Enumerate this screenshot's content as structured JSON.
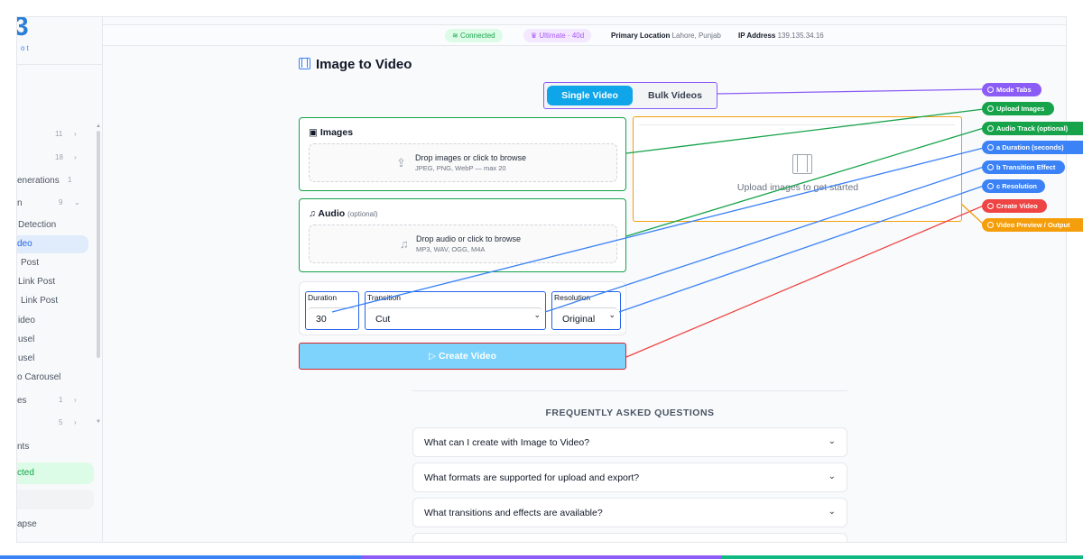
{
  "sidebar": {
    "logo_mark": "3",
    "logo_sub": "ot",
    "items": [
      {
        "label": "",
        "count": "11"
      },
      {
        "label": "",
        "count": "18"
      },
      {
        "label": "enerations",
        "count": "1"
      },
      {
        "label": "n",
        "count": "9"
      },
      {
        "label": "Detection",
        "count": ""
      },
      {
        "label": "deo",
        "count": ""
      },
      {
        "label": "Post",
        "count": ""
      },
      {
        "label": "Link Post",
        "count": ""
      },
      {
        "label": "Link Post",
        "count": ""
      },
      {
        "label": "ideo",
        "count": ""
      },
      {
        "label": "usel",
        "count": ""
      },
      {
        "label": "usel",
        "count": ""
      },
      {
        "label": "o Carousel",
        "count": ""
      },
      {
        "label": "es",
        "count": "1"
      },
      {
        "label": "",
        "count": "5"
      }
    ],
    "bottom_item": "nts",
    "status": "cted",
    "collapse": "apse"
  },
  "topbar": {
    "connected": "Connected",
    "plan": "Ultimate · 40d",
    "location_label": "Primary Location",
    "location_value": "Lahore, Punjab",
    "ip_label": "IP Address",
    "ip_value": "139.135.34.16"
  },
  "main": {
    "title": "Image to Video",
    "tabs": [
      {
        "label": "Single Video",
        "active": true
      },
      {
        "label": "Bulk Videos",
        "active": false
      }
    ],
    "images": {
      "title": "Images",
      "drop_text": "Drop images or click to browse",
      "formats": "JPEG, PNG, WebP — max 20"
    },
    "audio": {
      "title": "Audio",
      "optional": "(optional)",
      "drop_text": "Drop audio or click to browse",
      "formats": "MP3, WAV, OGG, M4A"
    },
    "preview_text": "Upload images to get started",
    "settings": {
      "duration_label": "Duration",
      "duration_value": "30",
      "transition_label": "Transition",
      "transition_value": "Cut",
      "resolution_label": "Resolution",
      "resolution_value": "Original"
    },
    "create_button": "Create Video"
  },
  "faq": {
    "heading": "FREQUENTLY ASKED QUESTIONS",
    "items": [
      "What can I create with Image to Video?",
      "What formats are supported for upload and export?",
      "What transitions and effects are available?"
    ]
  },
  "annotations": [
    {
      "label": "Mode Tabs",
      "color": "#8b5cf6"
    },
    {
      "label": "Upload Images",
      "color": "#16a34a"
    },
    {
      "label": "Audio Track (optional)",
      "color": "#16a34a"
    },
    {
      "label": "a Duration (seconds)",
      "color": "#3b82f6"
    },
    {
      "label": "b Transition Effect",
      "color": "#3b82f6"
    },
    {
      "label": "c Resolution",
      "color": "#3b82f6"
    },
    {
      "label": "Create Video",
      "color": "#ef4444"
    },
    {
      "label": "Video Preview / Output",
      "color": "#f59e0b"
    }
  ],
  "colors": {
    "accent": "#0ea5e9",
    "create_button": "#7dd3fc",
    "connected": "#16a34a",
    "plan": "#a855f7"
  }
}
